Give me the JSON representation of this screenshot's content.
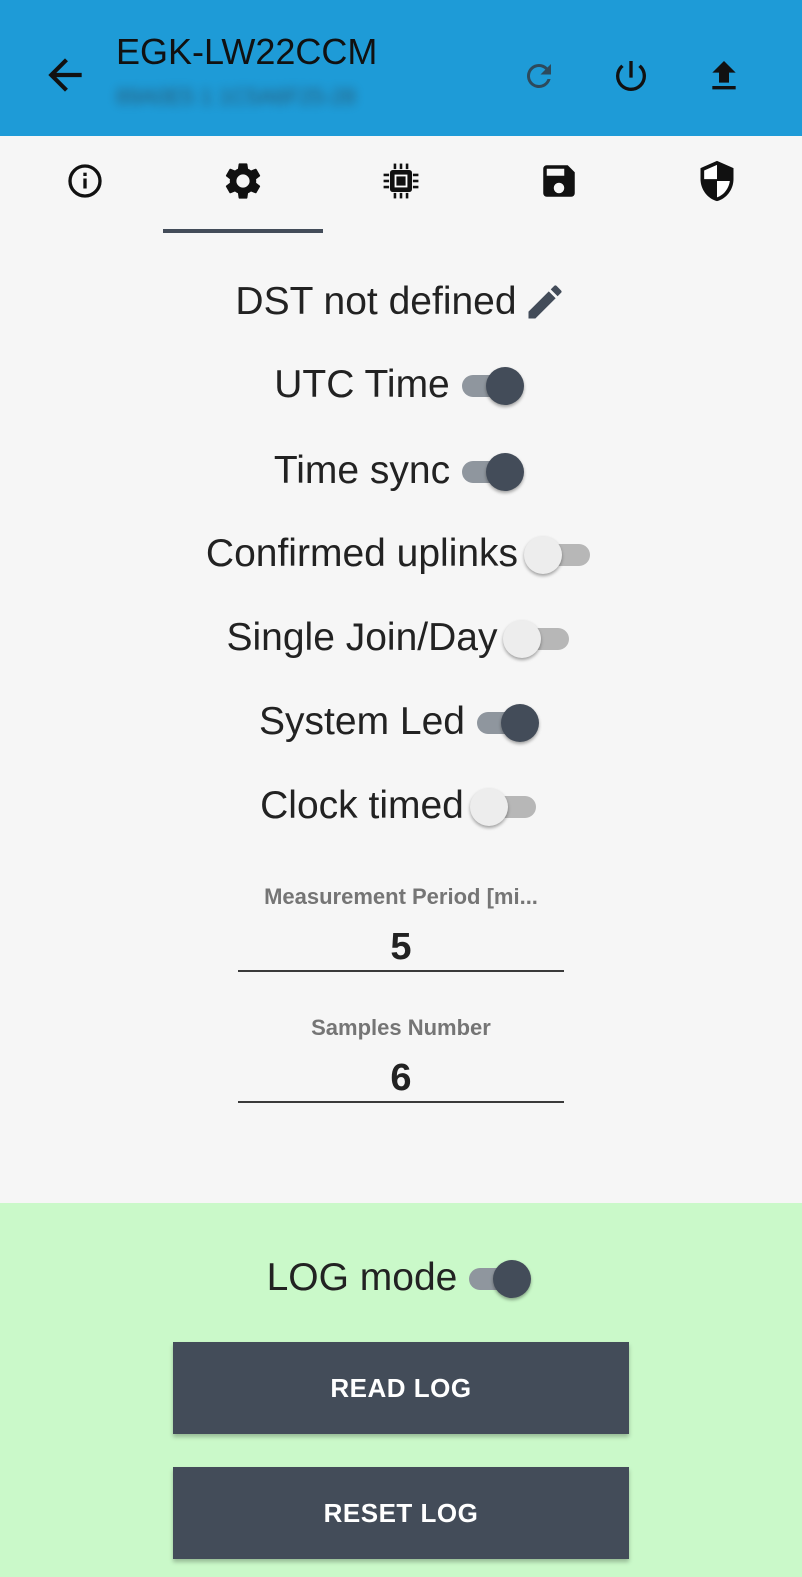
{
  "appbar": {
    "title": "EGK-LW22CCM",
    "subtitle": "89A0E5 1 1C5A6F25-28",
    "icons": [
      "back-arrow-icon",
      "refresh-icon",
      "power-icon",
      "upload-icon"
    ],
    "color": "#1e9bd7"
  },
  "tabs": {
    "items": [
      "info-icon",
      "gear-icon",
      "chip-icon",
      "save-icon",
      "shield-icon"
    ],
    "selected_index": 1
  },
  "settings": {
    "dst_label": "DST not defined",
    "toggles": [
      {
        "label": "UTC Time",
        "on": true
      },
      {
        "label": "Time sync",
        "on": true
      },
      {
        "label": "Confirmed uplinks",
        "on": false
      },
      {
        "label": "Single Join/Day",
        "on": false
      },
      {
        "label": "System Led",
        "on": true
      },
      {
        "label": "Clock timed",
        "on": false
      }
    ]
  },
  "fields": {
    "measurement_period": {
      "label": "Measurement Period [mi...",
      "value": "5"
    },
    "samples_number": {
      "label": "Samples Number",
      "value": "6"
    }
  },
  "log": {
    "mode_label": "LOG mode",
    "mode_on": true,
    "read_label": "READ LOG",
    "reset_label": "RESET LOG",
    "panel_color": "#caf9c9"
  },
  "colors": {
    "accent_dark": "#434c59"
  }
}
